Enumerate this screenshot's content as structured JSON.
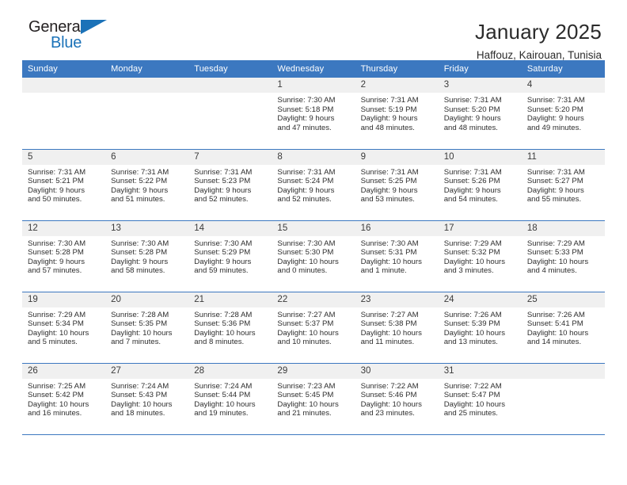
{
  "brand": {
    "name_top": "General",
    "name_bottom": "Blue",
    "accent_color": "#1b72b8"
  },
  "header": {
    "title": "January 2025",
    "subtitle": "Haffouz, Kairouan, Tunisia",
    "header_bg": "#3c78c0"
  },
  "calendar": {
    "weekday_headers": [
      "Sunday",
      "Monday",
      "Tuesday",
      "Wednesday",
      "Thursday",
      "Friday",
      "Saturday"
    ],
    "labels": {
      "sunrise": "Sunrise:",
      "sunset": "Sunset:",
      "daylight": "Daylight:"
    },
    "weeks": [
      [
        {
          "day": "",
          "empty": true
        },
        {
          "day": "",
          "empty": true
        },
        {
          "day": "",
          "empty": true
        },
        {
          "day": "1",
          "sunrise": "Sunrise: 7:30 AM",
          "sunset": "Sunset: 5:18 PM",
          "daylight_1": "Daylight: 9 hours",
          "daylight_2": "and 47 minutes."
        },
        {
          "day": "2",
          "sunrise": "Sunrise: 7:31 AM",
          "sunset": "Sunset: 5:19 PM",
          "daylight_1": "Daylight: 9 hours",
          "daylight_2": "and 48 minutes."
        },
        {
          "day": "3",
          "sunrise": "Sunrise: 7:31 AM",
          "sunset": "Sunset: 5:20 PM",
          "daylight_1": "Daylight: 9 hours",
          "daylight_2": "and 48 minutes."
        },
        {
          "day": "4",
          "sunrise": "Sunrise: 7:31 AM",
          "sunset": "Sunset: 5:20 PM",
          "daylight_1": "Daylight: 9 hours",
          "daylight_2": "and 49 minutes."
        }
      ],
      [
        {
          "day": "5",
          "sunrise": "Sunrise: 7:31 AM",
          "sunset": "Sunset: 5:21 PM",
          "daylight_1": "Daylight: 9 hours",
          "daylight_2": "and 50 minutes."
        },
        {
          "day": "6",
          "sunrise": "Sunrise: 7:31 AM",
          "sunset": "Sunset: 5:22 PM",
          "daylight_1": "Daylight: 9 hours",
          "daylight_2": "and 51 minutes."
        },
        {
          "day": "7",
          "sunrise": "Sunrise: 7:31 AM",
          "sunset": "Sunset: 5:23 PM",
          "daylight_1": "Daylight: 9 hours",
          "daylight_2": "and 52 minutes."
        },
        {
          "day": "8",
          "sunrise": "Sunrise: 7:31 AM",
          "sunset": "Sunset: 5:24 PM",
          "daylight_1": "Daylight: 9 hours",
          "daylight_2": "and 52 minutes."
        },
        {
          "day": "9",
          "sunrise": "Sunrise: 7:31 AM",
          "sunset": "Sunset: 5:25 PM",
          "daylight_1": "Daylight: 9 hours",
          "daylight_2": "and 53 minutes."
        },
        {
          "day": "10",
          "sunrise": "Sunrise: 7:31 AM",
          "sunset": "Sunset: 5:26 PM",
          "daylight_1": "Daylight: 9 hours",
          "daylight_2": "and 54 minutes."
        },
        {
          "day": "11",
          "sunrise": "Sunrise: 7:31 AM",
          "sunset": "Sunset: 5:27 PM",
          "daylight_1": "Daylight: 9 hours",
          "daylight_2": "and 55 minutes."
        }
      ],
      [
        {
          "day": "12",
          "sunrise": "Sunrise: 7:30 AM",
          "sunset": "Sunset: 5:28 PM",
          "daylight_1": "Daylight: 9 hours",
          "daylight_2": "and 57 minutes."
        },
        {
          "day": "13",
          "sunrise": "Sunrise: 7:30 AM",
          "sunset": "Sunset: 5:28 PM",
          "daylight_1": "Daylight: 9 hours",
          "daylight_2": "and 58 minutes."
        },
        {
          "day": "14",
          "sunrise": "Sunrise: 7:30 AM",
          "sunset": "Sunset: 5:29 PM",
          "daylight_1": "Daylight: 9 hours",
          "daylight_2": "and 59 minutes."
        },
        {
          "day": "15",
          "sunrise": "Sunrise: 7:30 AM",
          "sunset": "Sunset: 5:30 PM",
          "daylight_1": "Daylight: 10 hours",
          "daylight_2": "and 0 minutes."
        },
        {
          "day": "16",
          "sunrise": "Sunrise: 7:30 AM",
          "sunset": "Sunset: 5:31 PM",
          "daylight_1": "Daylight: 10 hours",
          "daylight_2": "and 1 minute."
        },
        {
          "day": "17",
          "sunrise": "Sunrise: 7:29 AM",
          "sunset": "Sunset: 5:32 PM",
          "daylight_1": "Daylight: 10 hours",
          "daylight_2": "and 3 minutes."
        },
        {
          "day": "18",
          "sunrise": "Sunrise: 7:29 AM",
          "sunset": "Sunset: 5:33 PM",
          "daylight_1": "Daylight: 10 hours",
          "daylight_2": "and 4 minutes."
        }
      ],
      [
        {
          "day": "19",
          "sunrise": "Sunrise: 7:29 AM",
          "sunset": "Sunset: 5:34 PM",
          "daylight_1": "Daylight: 10 hours",
          "daylight_2": "and 5 minutes."
        },
        {
          "day": "20",
          "sunrise": "Sunrise: 7:28 AM",
          "sunset": "Sunset: 5:35 PM",
          "daylight_1": "Daylight: 10 hours",
          "daylight_2": "and 7 minutes."
        },
        {
          "day": "21",
          "sunrise": "Sunrise: 7:28 AM",
          "sunset": "Sunset: 5:36 PM",
          "daylight_1": "Daylight: 10 hours",
          "daylight_2": "and 8 minutes."
        },
        {
          "day": "22",
          "sunrise": "Sunrise: 7:27 AM",
          "sunset": "Sunset: 5:37 PM",
          "daylight_1": "Daylight: 10 hours",
          "daylight_2": "and 10 minutes."
        },
        {
          "day": "23",
          "sunrise": "Sunrise: 7:27 AM",
          "sunset": "Sunset: 5:38 PM",
          "daylight_1": "Daylight: 10 hours",
          "daylight_2": "and 11 minutes."
        },
        {
          "day": "24",
          "sunrise": "Sunrise: 7:26 AM",
          "sunset": "Sunset: 5:39 PM",
          "daylight_1": "Daylight: 10 hours",
          "daylight_2": "and 13 minutes."
        },
        {
          "day": "25",
          "sunrise": "Sunrise: 7:26 AM",
          "sunset": "Sunset: 5:41 PM",
          "daylight_1": "Daylight: 10 hours",
          "daylight_2": "and 14 minutes."
        }
      ],
      [
        {
          "day": "26",
          "sunrise": "Sunrise: 7:25 AM",
          "sunset": "Sunset: 5:42 PM",
          "daylight_1": "Daylight: 10 hours",
          "daylight_2": "and 16 minutes."
        },
        {
          "day": "27",
          "sunrise": "Sunrise: 7:24 AM",
          "sunset": "Sunset: 5:43 PM",
          "daylight_1": "Daylight: 10 hours",
          "daylight_2": "and 18 minutes."
        },
        {
          "day": "28",
          "sunrise": "Sunrise: 7:24 AM",
          "sunset": "Sunset: 5:44 PM",
          "daylight_1": "Daylight: 10 hours",
          "daylight_2": "and 19 minutes."
        },
        {
          "day": "29",
          "sunrise": "Sunrise: 7:23 AM",
          "sunset": "Sunset: 5:45 PM",
          "daylight_1": "Daylight: 10 hours",
          "daylight_2": "and 21 minutes."
        },
        {
          "day": "30",
          "sunrise": "Sunrise: 7:22 AM",
          "sunset": "Sunset: 5:46 PM",
          "daylight_1": "Daylight: 10 hours",
          "daylight_2": "and 23 minutes."
        },
        {
          "day": "31",
          "sunrise": "Sunrise: 7:22 AM",
          "sunset": "Sunset: 5:47 PM",
          "daylight_1": "Daylight: 10 hours",
          "daylight_2": "and 25 minutes."
        },
        {
          "day": "",
          "empty": true
        }
      ]
    ]
  }
}
